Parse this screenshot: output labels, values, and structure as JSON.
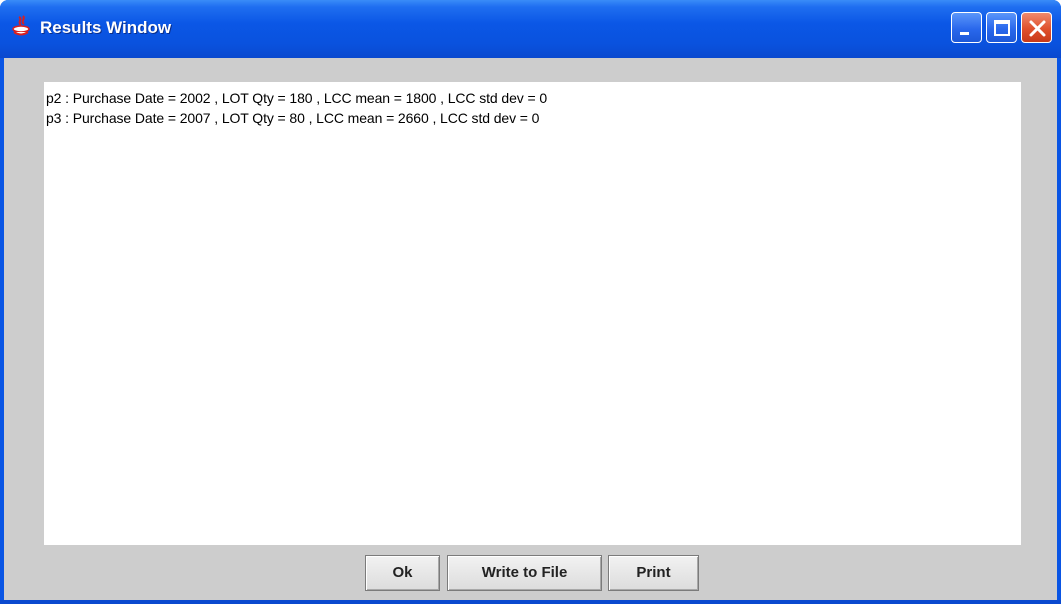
{
  "window": {
    "title": "Results Window",
    "icon": "java-app-icon",
    "controls": {
      "minimize": "minimize-icon",
      "maximize": "maximize-icon",
      "close": "close-icon"
    },
    "title_bar_color": "#0a55e4"
  },
  "results": {
    "lines": [
      "p2 : Purchase Date = 2002 , LOT Qty = 180 , LCC mean = 1800 , LCC std dev = 0",
      "p3 : Purchase Date = 2007 , LOT Qty = 80 , LCC mean = 2660 , LCC std dev = 0"
    ]
  },
  "buttons": {
    "ok": "Ok",
    "write": "Write to File",
    "print": "Print"
  }
}
